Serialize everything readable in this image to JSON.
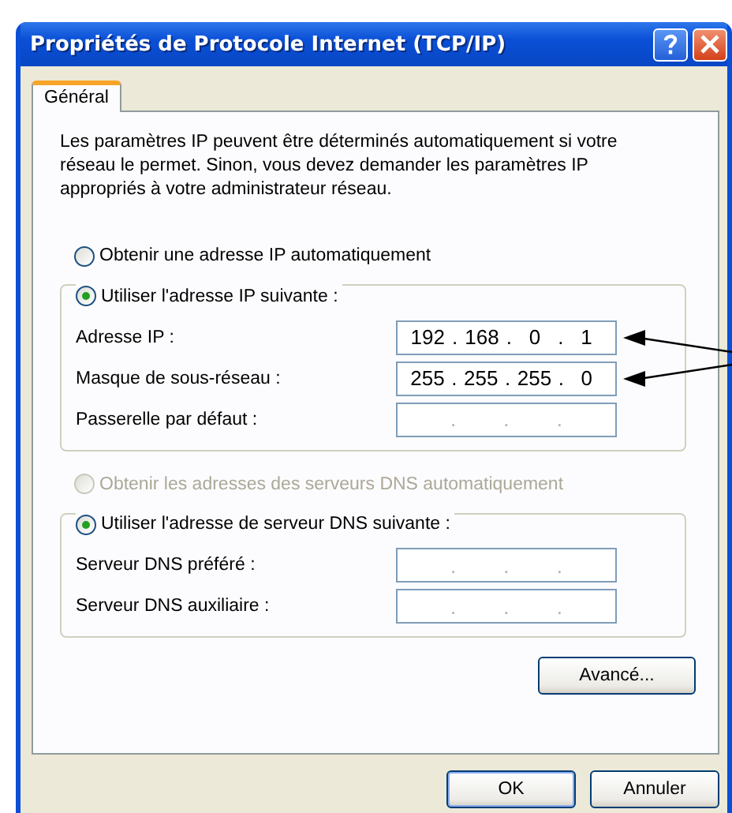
{
  "window": {
    "title": "Propriétés de Protocole Internet (TCP/IP)"
  },
  "tabs": [
    {
      "label": "Général",
      "selected": true
    }
  ],
  "intro": "Les paramètres IP peuvent être déterminés automatiquement si votre réseau le permet. Sinon, vous devez demander les paramètres IP appropriés à votre administrateur réseau.",
  "sections": [
    {
      "radios": [
        {
          "label": "Obtenir une adresse IP automatiquement",
          "selected": false,
          "disabled": false
        },
        {
          "label": "Utiliser l'adresse IP suivante :",
          "selected": true,
          "disabled": false
        }
      ],
      "fields": [
        {
          "label": "Adresse IP :",
          "octets": [
            "192",
            "168",
            "0",
            "1"
          ],
          "separators": [
            ".",
            ".",
            "."
          ],
          "arrow": true
        },
        {
          "label": "Masque de sous-réseau :",
          "octets": [
            "255",
            "255",
            "255",
            "0"
          ],
          "separators": [
            ".",
            ".",
            "."
          ],
          "arrow": true
        },
        {
          "label": "Passerelle par défaut :",
          "separators": [
            ".",
            ".",
            "."
          ],
          "arrow": false
        }
      ]
    },
    {
      "radios": [
        {
          "label": "Obtenir les adresses des serveurs DNS automatiquement",
          "selected": false,
          "disabled": true
        },
        {
          "label": "Utiliser l'adresse de serveur DNS suivante :",
          "selected": true,
          "disabled": false
        }
      ],
      "fields": [
        {
          "label": "Serveur DNS préféré :",
          "separators": [
            ".",
            ".",
            "."
          ],
          "arrow": false
        },
        {
          "label": "Serveur DNS auxiliaire :",
          "separators": [
            ".",
            ".",
            "."
          ],
          "arrow": false
        }
      ]
    }
  ],
  "advanced_button": "Avancé...",
  "buttons": [
    "OK",
    "Annuler"
  ]
}
